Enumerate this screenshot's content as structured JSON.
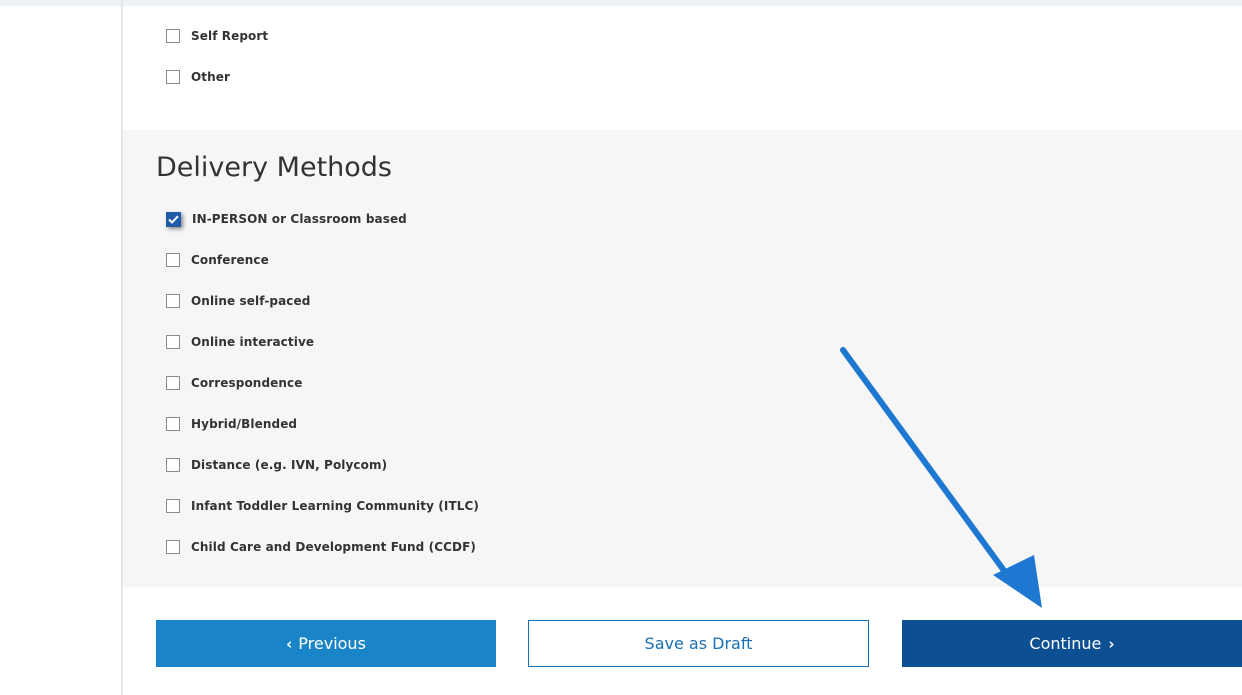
{
  "prior_checkboxes": [
    {
      "label": "Self Report",
      "checked": false
    },
    {
      "label": "Other",
      "checked": false
    }
  ],
  "delivery_methods": {
    "title": "Delivery Methods",
    "items": [
      {
        "label": "IN-PERSON or Classroom based",
        "checked": true
      },
      {
        "label": "Conference",
        "checked": false
      },
      {
        "label": "Online self-paced",
        "checked": false
      },
      {
        "label": "Online interactive",
        "checked": false
      },
      {
        "label": "Correspondence",
        "checked": false
      },
      {
        "label": "Hybrid/Blended",
        "checked": false
      },
      {
        "label": "Distance (e.g. IVN, Polycom)",
        "checked": false
      },
      {
        "label": "Infant Toddler Learning Community (ITLC)",
        "checked": false
      },
      {
        "label": "Child Care and Development Fund (CCDF)",
        "checked": false
      }
    ]
  },
  "buttons": {
    "previous_label": "Previous",
    "save_draft_label": "Save as Draft",
    "continue_label": "Continue"
  },
  "icons": {
    "checkmark": "check-icon",
    "prev_chevron": "chevron-left-icon",
    "next_chevron": "chevron-right-icon",
    "annotation": "arrow-annotation"
  },
  "colors": {
    "previous_bg": "#1a84c8",
    "continue_bg": "#0d4f93",
    "draft_border": "#1a6fb5",
    "checkbox_checked": "#1f5aa6",
    "annotation_arrow": "#1e78d2",
    "section_bg": "#f6f6f6"
  }
}
